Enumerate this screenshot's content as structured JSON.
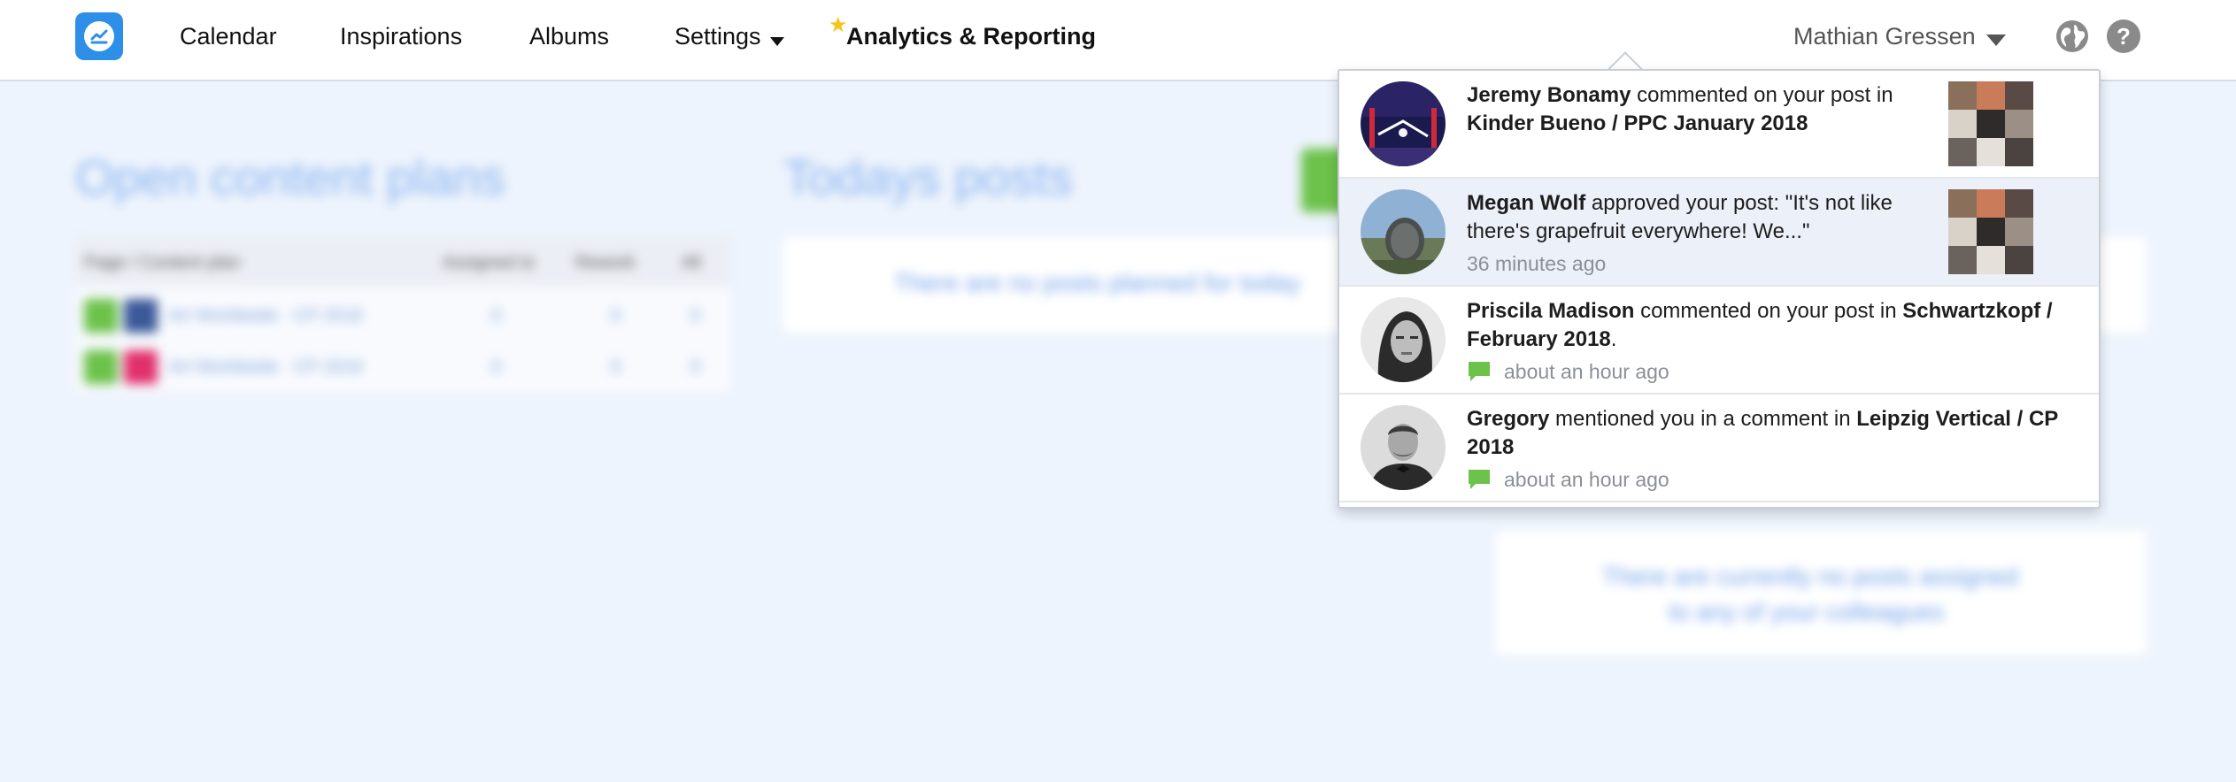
{
  "nav": {
    "items": [
      "Calendar",
      "Inspirations",
      "Albums",
      "Settings",
      "Analytics & Reporting"
    ],
    "user_name": "Mathian Gressen",
    "help_glyph": "?"
  },
  "background": {
    "left_title": "Open content plans",
    "right_title": "Todays posts",
    "table_headers": [
      "Page / Content plan",
      "Assigned to",
      "Rework",
      "All"
    ],
    "table_rows": [
      {
        "name": "Art Worldwide · CP 2018",
        "assigned": "0",
        "rework": "0",
        "all": "0"
      },
      {
        "name": "Art Worldwide · CP 2018",
        "assigned": "0",
        "rework": "0",
        "all": "0"
      }
    ],
    "card_1_text": "There are no posts planned for today",
    "card_2_line_1": "There are currently no posts assigned",
    "card_2_line_2": "to any of your colleagues"
  },
  "notifications": [
    {
      "actor": "Jeremy Bonamy",
      "action": " commented on your post in ",
      "target": "Kinder Bueno / PPC January 2018",
      "time": ""
    },
    {
      "actor": "Megan Wolf",
      "action": " approved your post: \"It's not like there's grapefruit everywhere! We...\"",
      "target": "",
      "time": "36 minutes ago"
    },
    {
      "actor": "Priscila Madison",
      "action": " commented on your post in ",
      "target": "Schwartzkopf / February 2018",
      "suffix": ".",
      "time": "about an hour ago"
    },
    {
      "actor": "Gregory",
      "action": " mentioned you in a comment in ",
      "target": "Leipzig Vertical / CP 2018",
      "time": "about an hour ago"
    }
  ],
  "colors": {
    "brand": "#2d8fe8",
    "comment_icon": "#6cc24a",
    "highlight_row": "#ecf0f8",
    "page_background": "#eef4fd"
  },
  "icons": [
    "app-logo-icon",
    "star-icon",
    "chevron-down-icon",
    "globe-notification-icon",
    "help-icon",
    "comment-icon"
  ]
}
